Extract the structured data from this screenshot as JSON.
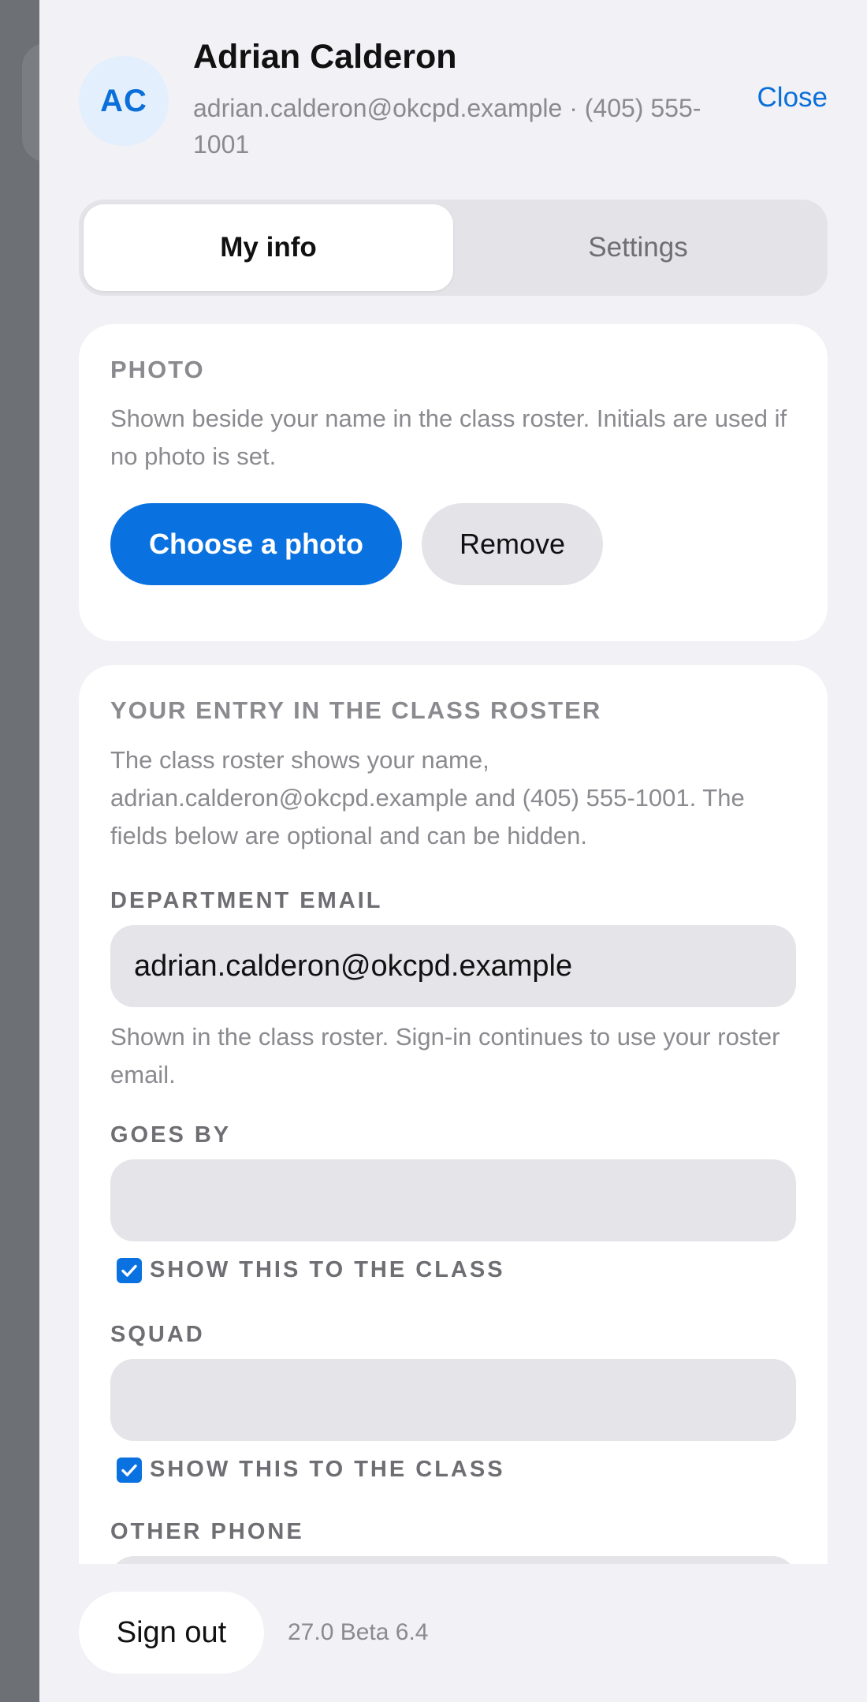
{
  "header": {
    "initials": "AC",
    "name": "Adrian Calderon",
    "contact": "adrian.calderon@okcpd.example · (405) 555-1001",
    "close_label": "Close"
  },
  "tabs": [
    {
      "label": "My info",
      "active": true
    },
    {
      "label": "Settings",
      "active": false
    }
  ],
  "photo_section": {
    "title": "PHOTO",
    "description": "Shown beside your name in the class roster. Initials are used if no photo is set.",
    "choose_label": "Choose a photo",
    "remove_label": "Remove"
  },
  "roster_section": {
    "title": "YOUR ENTRY IN THE CLASS ROSTER",
    "description": "The class roster shows your name, adrian.calderon@okcpd.example and (405) 555-1001. The fields below are optional and can be hidden.",
    "department_email": {
      "label": "DEPARTMENT EMAIL",
      "value": "adrian.calderon@okcpd.example",
      "helper": "Shown in the class roster. Sign-in continues to use your roster email."
    },
    "goes_by": {
      "label": "GOES BY",
      "value": "",
      "show_label": "SHOW THIS TO THE CLASS",
      "show_checked": true
    },
    "squad": {
      "label": "SQUAD",
      "value": "",
      "show_label": "SHOW THIS TO THE CLASS",
      "show_checked": true
    },
    "other_phone": {
      "label": "OTHER PHONE",
      "value": ""
    }
  },
  "footer": {
    "sign_out_label": "Sign out",
    "version": "27.0 Beta 6.4"
  },
  "colors": {
    "accent": "#0a72e0",
    "link": "#0a6fd8",
    "sheet_bg": "#f1f1f6",
    "field_bg": "#e4e4e9"
  }
}
